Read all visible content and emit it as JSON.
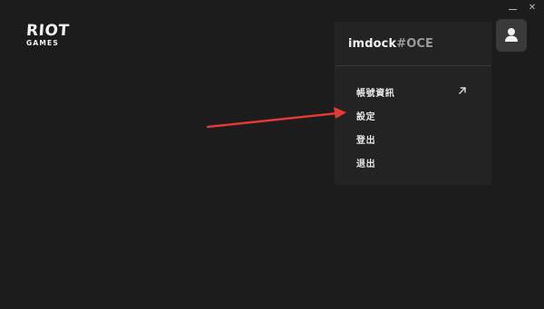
{
  "logo": {
    "main": "RIOT",
    "sub": "GAMES"
  },
  "window_controls": {
    "minimize_icon": "minimize-icon",
    "close_label": "✕"
  },
  "profile": {
    "icon": "user-icon",
    "username": "imdock",
    "tagline": "#OCE"
  },
  "menu": {
    "items": [
      {
        "label": "帳號資訊",
        "icon": "external-link-icon"
      },
      {
        "label": "設定"
      },
      {
        "label": "登出"
      },
      {
        "label": "退出"
      }
    ]
  },
  "colors": {
    "background": "#1c1c1c",
    "dropdown": "#232323",
    "profile_button": "#3a3a3a",
    "annotation_arrow": "#e53935"
  }
}
